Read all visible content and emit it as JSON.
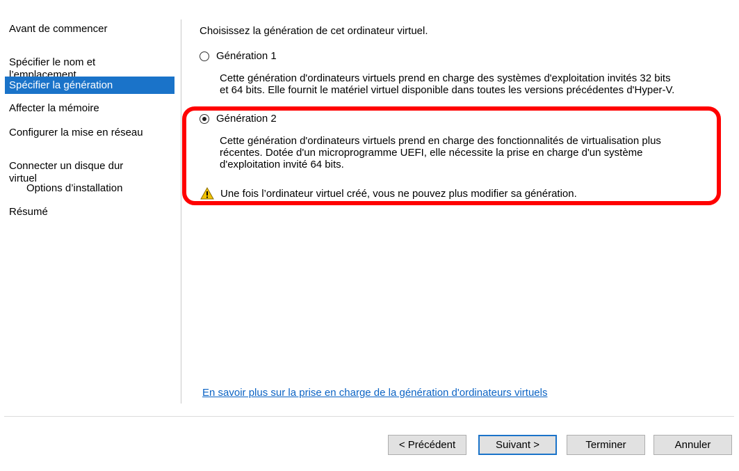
{
  "sidebar": {
    "items": [
      {
        "label": "Avant de commencer"
      },
      {
        "label": "Spécifier le nom et\nl’emplacement"
      },
      {
        "label": "Spécifier la génération"
      },
      {
        "label": "Affecter la mémoire"
      },
      {
        "label": "Configurer la mise en réseau"
      },
      {
        "label": "Connecter un disque dur\nvirtuel"
      },
      {
        "label": "Options d’installation"
      },
      {
        "label": "Résumé"
      }
    ],
    "active_index": 2
  },
  "main": {
    "prompt": "Choisissez la génération de cet ordinateur virtuel.",
    "options": [
      {
        "label": "Génération 1",
        "selected": false,
        "description": "Cette génération d'ordinateurs virtuels prend en charge des systèmes d'exploitation invités 32 bits\net 64 bits. Elle fournit le matériel virtuel disponible dans toutes les versions précédentes d'Hyper-V."
      },
      {
        "label": "Génération 2",
        "selected": true,
        "description": "Cette génération d'ordinateurs virtuels prend en charge des fonctionnalités de virtualisation plus\nrécentes. Dotée d'un microprogramme UEFI, elle nécessite la prise en charge d'un système\nd'exploitation invité 64 bits."
      }
    ],
    "warning": "Une fois l’ordinateur virtuel créé, vous ne pouvez plus modifier sa génération.",
    "warning_icon": "warning-triangle-icon",
    "learn_more_link": "En savoir plus sur la prise en charge de la génération d'ordinateurs virtuels"
  },
  "footer": {
    "buttons": {
      "previous": "< Précédent",
      "next": "Suivant >",
      "finish": "Terminer",
      "cancel": "Annuler"
    }
  },
  "colors": {
    "selection_blue": "#1a73c9",
    "highlight_red": "#ff0000",
    "link_blue": "#0b63c4",
    "warning_yellow": "#f2c200"
  }
}
